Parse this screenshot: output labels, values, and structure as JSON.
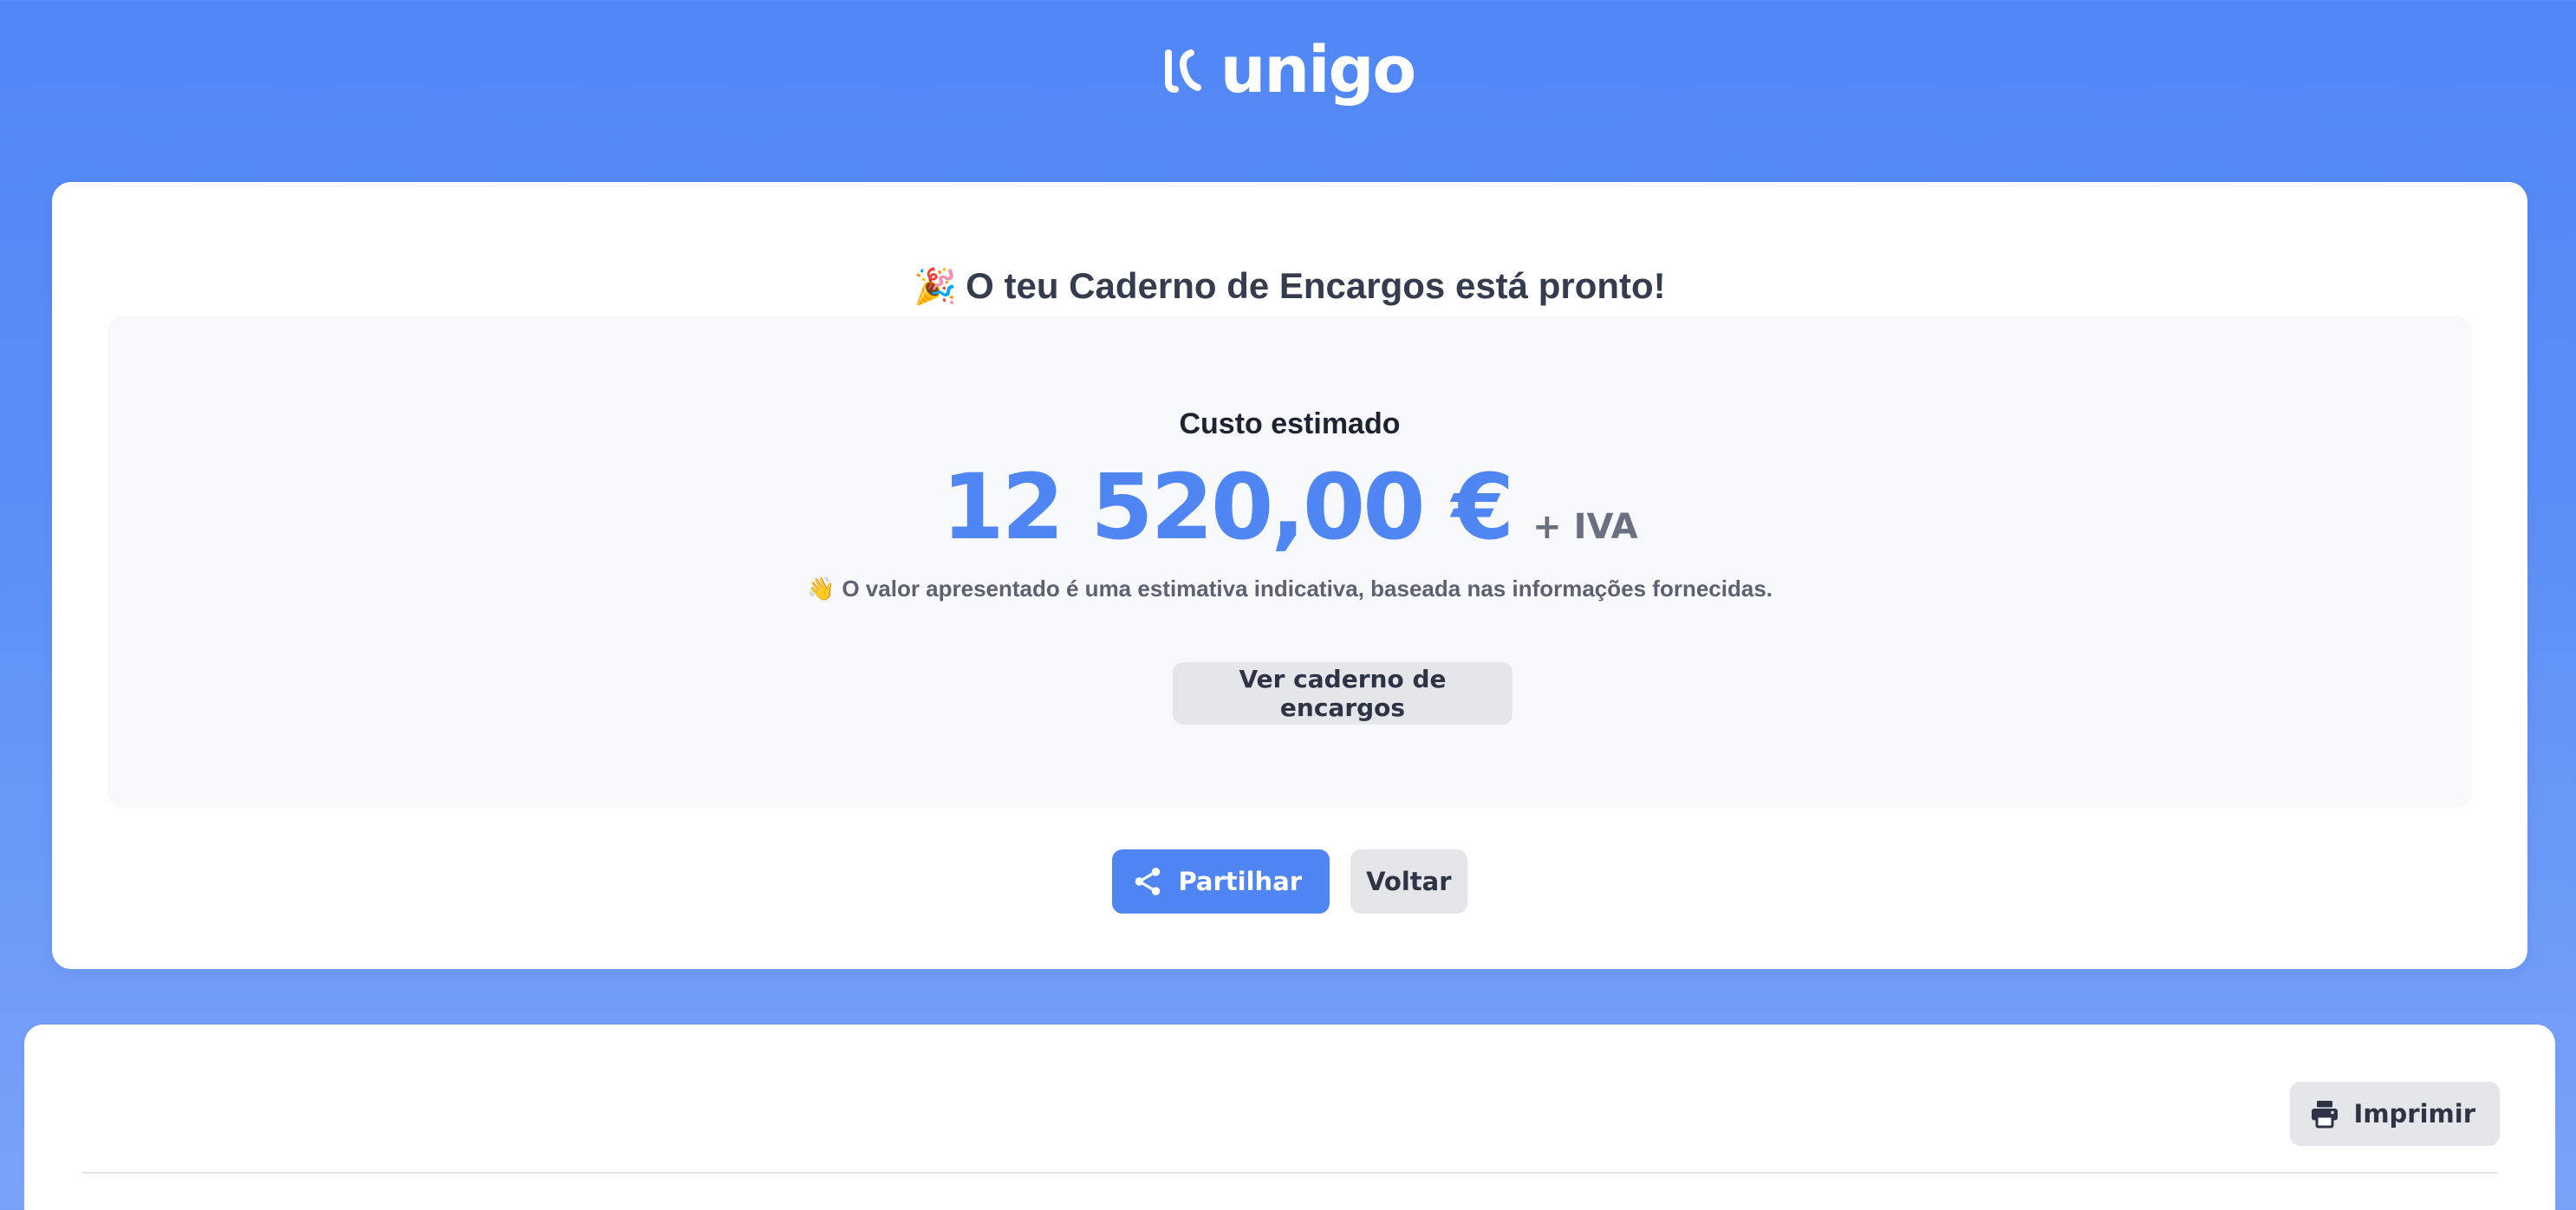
{
  "brand": {
    "name": "unigo",
    "logo_icon": "unigo-logo-icon"
  },
  "result": {
    "title_emoji": "🎉",
    "title": "O teu Caderno de Encargos está pronto!",
    "cost_label": "Custo estimado",
    "cost_value": "12 520,00 €",
    "cost_suffix": "+ IVA",
    "note_emoji": "👋",
    "note": "O valor apresentado é uma estimativa indicativa, baseada nas informações fornecidas.",
    "view_doc_label": "Ver caderno de encargos"
  },
  "actions": {
    "share_label": "Partilhar",
    "share_icon": "share-icon",
    "back_label": "Voltar"
  },
  "document": {
    "print_label": "Imprimir",
    "print_icon": "printer-icon"
  },
  "colors": {
    "accent": "#4f86f4",
    "background_top": "#5187f5",
    "background_bottom": "#7aa3f8",
    "button_secondary": "#e4e6ea",
    "panel": "#f8f9fb"
  }
}
